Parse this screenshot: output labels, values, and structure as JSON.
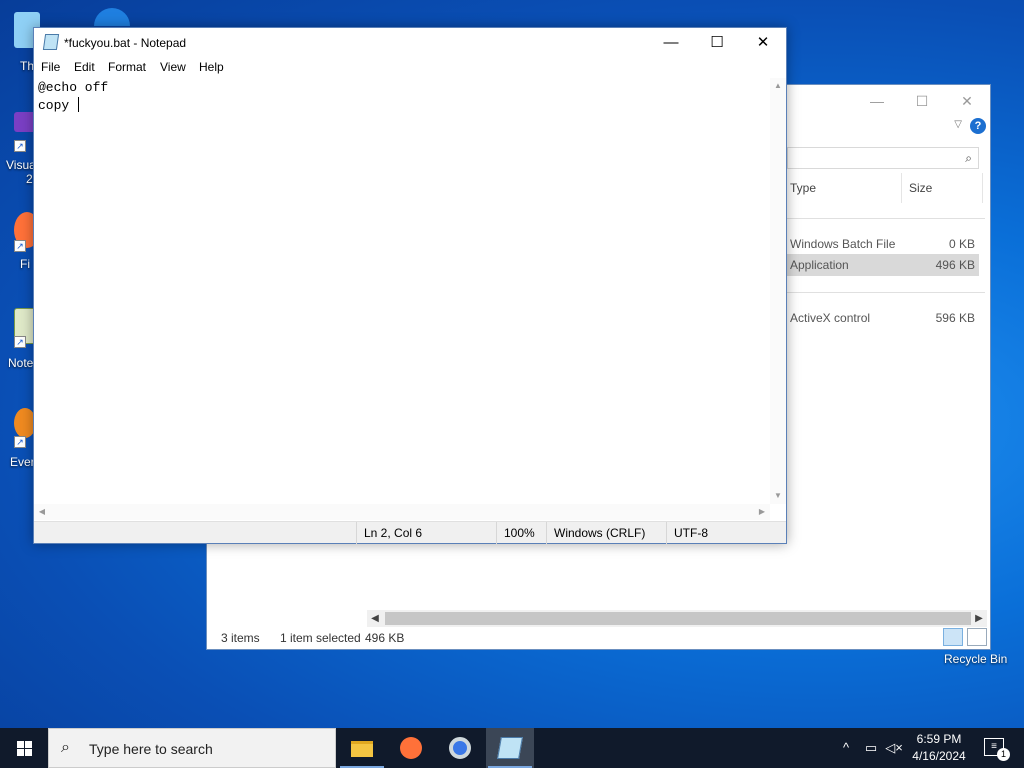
{
  "desktop": {
    "icons": [
      {
        "label": "Th"
      },
      {
        "label": "Visua"
      },
      {
        "label": "Fi"
      },
      {
        "label": "Note"
      },
      {
        "label": "Ever"
      }
    ],
    "icon_extra": {
      "visual_line2": "2"
    },
    "recycle_bin_label": "Recycle Bin"
  },
  "explorer": {
    "columns": {
      "type": "Type",
      "size": "Size"
    },
    "rows": [
      {
        "type": "Windows Batch File",
        "size": "0 KB",
        "selected": false
      },
      {
        "type": "Application",
        "size": "496 KB",
        "selected": true
      },
      {
        "type": "ActiveX control",
        "size": "596 KB",
        "selected": false
      }
    ],
    "status": {
      "items": "3 items",
      "selected": "1 item selected",
      "size": "496 KB"
    }
  },
  "notepad": {
    "title": "*fuckyou.bat - Notepad",
    "menu": [
      "File",
      "Edit",
      "Format",
      "View",
      "Help"
    ],
    "lines": [
      "@echo off",
      "copy "
    ],
    "status": {
      "position": "Ln 2, Col 6",
      "zoom": "100%",
      "line_ending": "Windows (CRLF)",
      "encoding": "UTF-8"
    }
  },
  "taskbar": {
    "search_placeholder": "Type here to search",
    "time": "6:59 PM",
    "date": "4/16/2024",
    "notification_count": "1"
  },
  "colors": {
    "accent": "#0078d7",
    "taskbar": "#101a2b",
    "selection": "#d9d9d9"
  }
}
